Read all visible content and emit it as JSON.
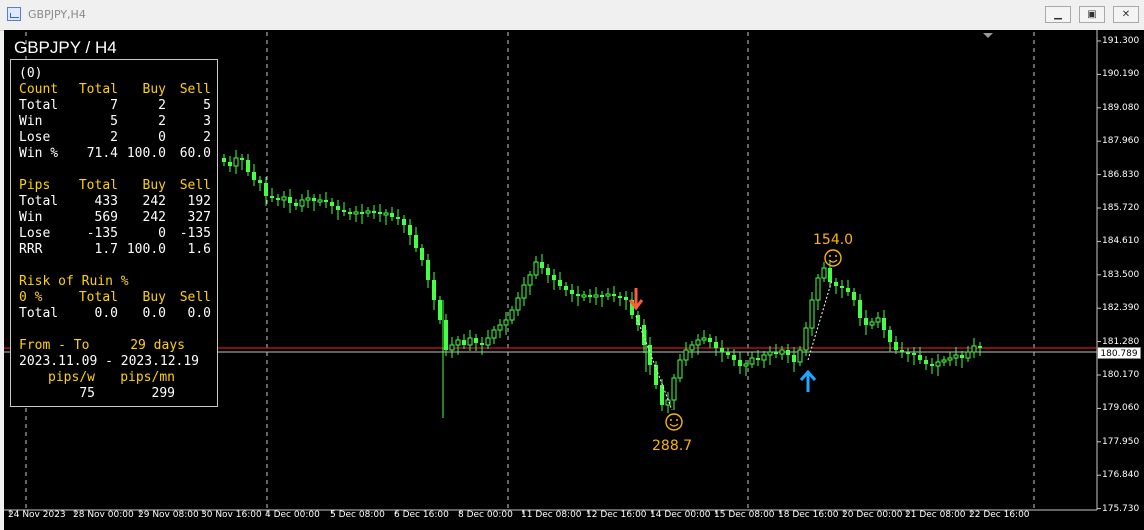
{
  "window": {
    "title": "GBPJPY,H4",
    "minimize_glyph": "▁",
    "restore_glyph": "▣",
    "close_glyph": "✕"
  },
  "chart": {
    "symbol_label": "GBPJPY / H4",
    "current_price": "180.789",
    "price_axis": [
      "191.300",
      "190.190",
      "189.080",
      "187.960",
      "186.830",
      "185.720",
      "184.610",
      "183.500",
      "182.390",
      "181.280",
      "180.170",
      "179.060",
      "177.950",
      "176.840",
      "175.730"
    ],
    "time_axis": [
      "24 Nov 2023",
      "28 Nov 00:00",
      "29 Nov 08:00",
      "30 Nov 16:00",
      "4 Dec 00:00",
      "5 Dec 08:00",
      "6 Dec 16:00",
      "8 Dec 00:00",
      "11 Dec 08:00",
      "12 Dec 16:00",
      "14 Dec 00:00",
      "15 Dec 08:00",
      "18 Dec 16:00",
      "20 Dec 00:00",
      "21 Dec 08:00",
      "22 Dec 16:00"
    ],
    "trade_labels": {
      "sell_result": "288.7",
      "buy_result": "154.0"
    },
    "colors": {
      "bull": "#44ff44",
      "bear": "#44ff44",
      "sell_arrow": "#ff5a3c",
      "buy_arrow": "#1ea7ff",
      "result_text": "#ffb400",
      "bid_line": "#ff2020",
      "ask_line": "#c0c0c0"
    }
  },
  "stats": {
    "header": "(0)",
    "count": {
      "title": "Count",
      "c1": "Total",
      "c2": "Buy",
      "c3": "Sell",
      "rows": [
        {
          "label": "Total",
          "v1": "7",
          "v2": "2",
          "v3": "5"
        },
        {
          "label": "Win",
          "v1": "5",
          "v2": "2",
          "v3": "3"
        },
        {
          "label": "Lose",
          "v1": "2",
          "v2": "0",
          "v3": "2"
        },
        {
          "label": "Win %",
          "v1": "71.4",
          "v2": "100.0",
          "v3": "60.0"
        }
      ]
    },
    "pips": {
      "title": "Pips",
      "c1": "Total",
      "c2": "Buy",
      "c3": "Sell",
      "rows": [
        {
          "label": "Total",
          "v1": "433",
          "v2": "242",
          "v3": "192"
        },
        {
          "label": "Win",
          "v1": "569",
          "v2": "242",
          "v3": "327"
        },
        {
          "label": "Lose",
          "v1": "-135",
          "v2": "0",
          "v3": "-135"
        },
        {
          "label": "RRR",
          "v1": "1.7",
          "v2": "100.0",
          "v3": "1.6"
        }
      ]
    },
    "risk": {
      "title": "Risk of Ruin %",
      "c0": "0 %",
      "c1": "Total",
      "c2": "Buy",
      "c3": "Sell",
      "rows": [
        {
          "label": "Total",
          "v1": "0.0",
          "v2": "0.0",
          "v3": "0.0"
        }
      ]
    },
    "range": {
      "title": "From - To",
      "days": "29 days",
      "dates": "2023.11.09 - 2023.12.19",
      "pw_label": "pips/w",
      "pm_label": "pips/mn",
      "pw": "75",
      "pm": "299"
    }
  }
}
